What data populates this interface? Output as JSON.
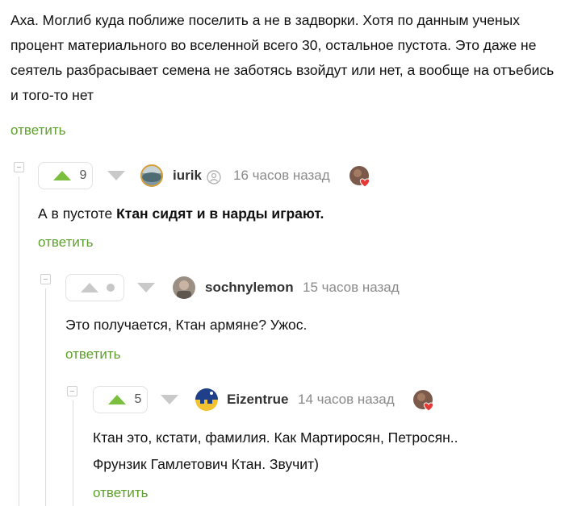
{
  "top_comment": {
    "text": "Аха. Моглиб куда поближе поселить а не в задворки. Хотя по данным ученых процент материального во вселенной всего 30, остальное пустота. Это даже не сеятель разбрасывает семена не заботясь взойдут или нет, а вообще на отъебись и того-то нет",
    "reply_label": "ответить"
  },
  "comments": [
    {
      "rating": "9",
      "username": "iurik",
      "time": "16 часов назад",
      "text_before": "А в пустоте ",
      "text_bold": "Ктан сидят и в нарды играют.",
      "reply_label": "ответить"
    },
    {
      "rating": "",
      "username": "sochnylemon",
      "time": "15 часов назад",
      "text": "Это получается, Ктан армяне? Ужос.",
      "reply_label": "ответить"
    },
    {
      "rating": "5",
      "username": "Eizentrue",
      "time": "14 часов назад",
      "text_line1": "Ктан это, кстати, фамилия. Как Мартиросян, Петросян..",
      "text_line2": "Фрунзик Гамлетович Ктан. Звучит)",
      "reply_label": "ответить"
    }
  ],
  "icons": {
    "upvote": "upvote-arrow-icon",
    "downvote": "downvote-arrow-icon",
    "collapse": "collapse-minus-icon",
    "verified": "user-badge-icon",
    "heart": "heart-icon"
  },
  "colors": {
    "upvote_active": "#7cbf3e",
    "reply_link": "#5f9f2e",
    "arrow_inactive": "#c9c9c9",
    "heart": "#e53935"
  }
}
